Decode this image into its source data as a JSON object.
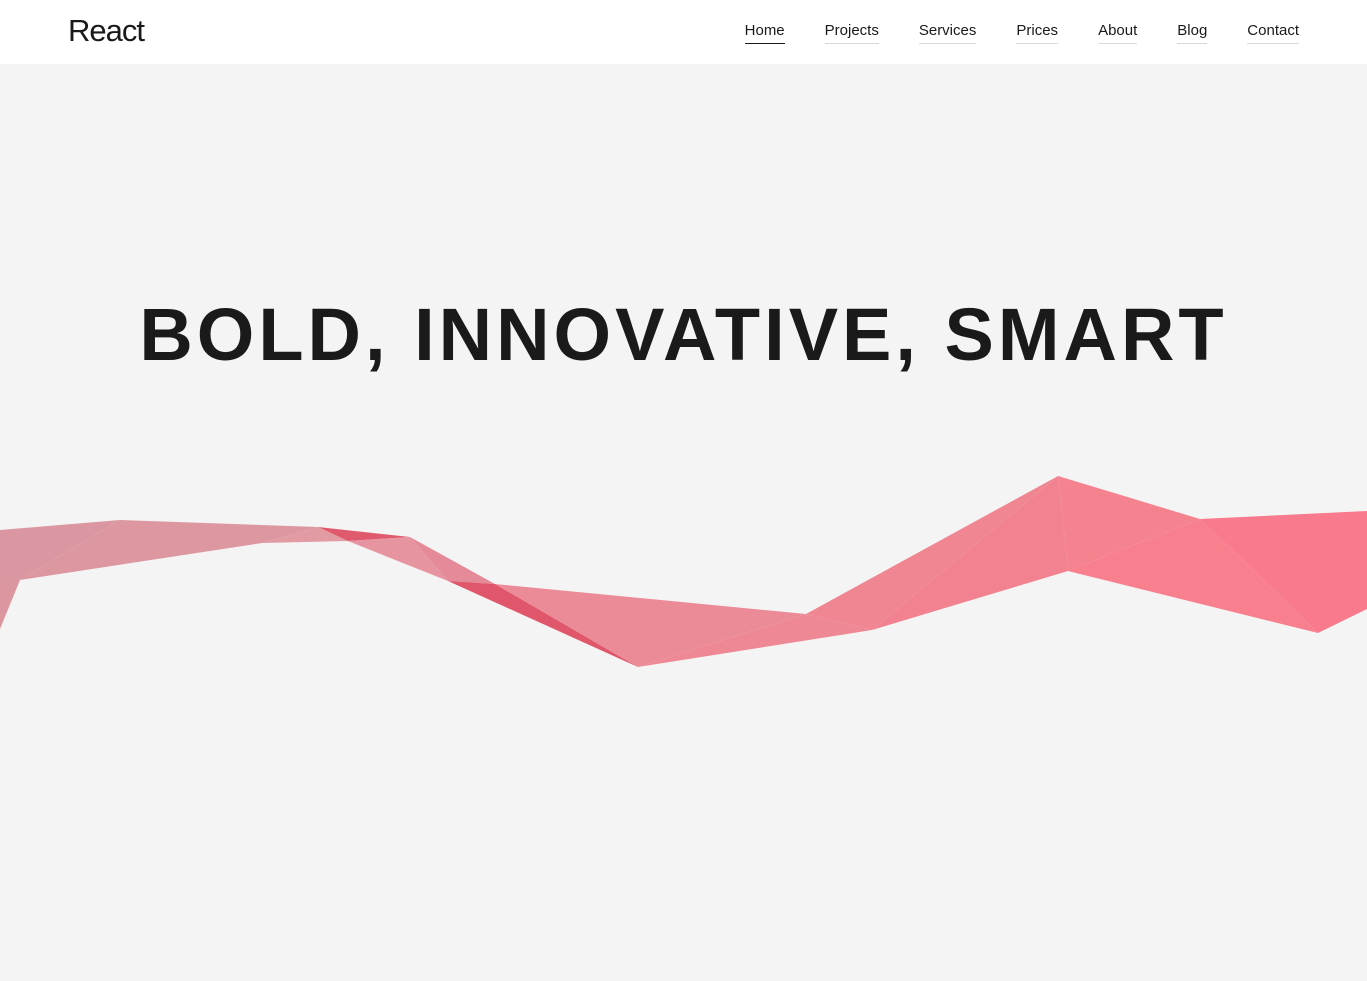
{
  "header": {
    "logo": "React",
    "nav": [
      {
        "label": "Home",
        "active": true
      },
      {
        "label": "Projects",
        "active": false
      },
      {
        "label": "Services",
        "active": false
      },
      {
        "label": "Prices",
        "active": false
      },
      {
        "label": "About",
        "active": false
      },
      {
        "label": "Blog",
        "active": false
      },
      {
        "label": "Contact",
        "active": false
      }
    ]
  },
  "hero": {
    "headline": "BOLD, INNOVATIVE, SMART",
    "ribbon_colors": [
      "#d9909b",
      "#e2606f",
      "#ee8492",
      "#f77a8c"
    ]
  },
  "colors": {
    "background": "#f4f4f4",
    "header_background": "#ffffff",
    "text": "#1a1a1a"
  }
}
